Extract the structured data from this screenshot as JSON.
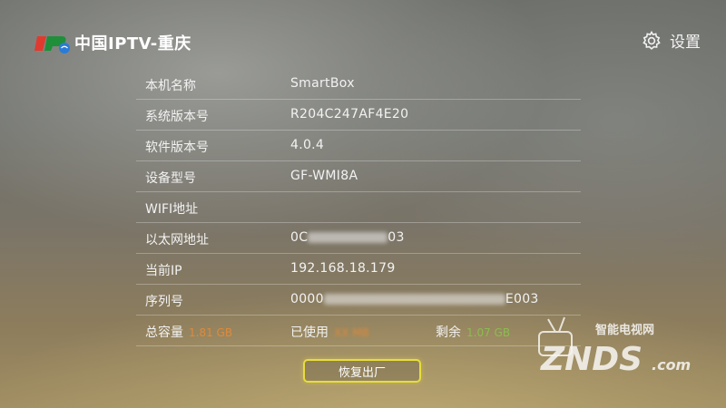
{
  "header": {
    "logo_text": "中国IPTV-重庆",
    "settings_label": "设置"
  },
  "info": [
    {
      "label": "本机名称",
      "value": "SmartBox"
    },
    {
      "label": "系统版本号",
      "value": "R204C247AF4E20"
    },
    {
      "label": "软件版本号",
      "value": "4.0.4"
    },
    {
      "label": "设备型号",
      "value": "GF-WMI8A"
    },
    {
      "label": "WIFI地址",
      "value": ""
    },
    {
      "label": "以太网地址",
      "value_prefix": "0C",
      "value_suffix": "03"
    },
    {
      "label": "当前IP",
      "value": "192.168.18.179"
    },
    {
      "label": "序列号",
      "value_prefix": "0000",
      "value_suffix": "E003"
    }
  ],
  "storage": {
    "total_label": "总容量",
    "total_value": "1.81 GB",
    "used_label": "已使用",
    "used_value": "XX MB",
    "free_label": "剩余",
    "free_value": "1.07 GB"
  },
  "reset_button": "恢复出厂",
  "watermark": {
    "line1": "智能电视网",
    "line2": "ZNDS",
    "line3": ".com"
  },
  "colors": {
    "focus_border": "#e7dd3c",
    "total_value": "#e08a3a",
    "free_value": "#8bbd4f"
  }
}
